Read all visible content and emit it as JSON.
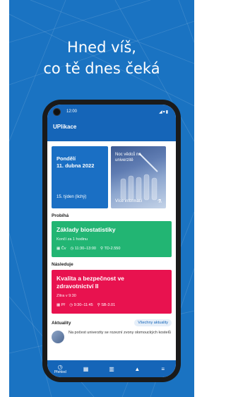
{
  "promo": {
    "headline_line1": "Hned víš,",
    "headline_line2": "co tě dnes čeká",
    "bg_color": "#1a73c2"
  },
  "status": {
    "time": "12:00",
    "icons": "◢▾▮"
  },
  "app": {
    "title": "UPlikace"
  },
  "date_card": {
    "day_name": "Pondělí",
    "date": "11. dubna 2022",
    "week": "15. týden (lichý)"
  },
  "news_card": {
    "caption": "Noc vědců na univerzitě",
    "more": "Více informací"
  },
  "current": {
    "section": "Probíhá",
    "title": "Základy biostatistiky",
    "sub": "Končí za 1 hodinu",
    "day": "Čv",
    "time": "11:30–13:00",
    "room": "TD-2.550",
    "color": "#22b573"
  },
  "next": {
    "section": "Následuje",
    "title": "Kvalita a bezpečnost ve zdravotnictví II",
    "sub": "Zítra v 9:30",
    "day": "Př",
    "time": "9:30–11:45",
    "room": "SB-3.01",
    "color": "#e8124f"
  },
  "news": {
    "heading": "Aktuality",
    "all_label": "Všechny aktuality",
    "item_text": "Na počest univerzity se rozezní zvony olomouckých kostelů"
  },
  "nav": {
    "overview_label": "Přehled"
  }
}
